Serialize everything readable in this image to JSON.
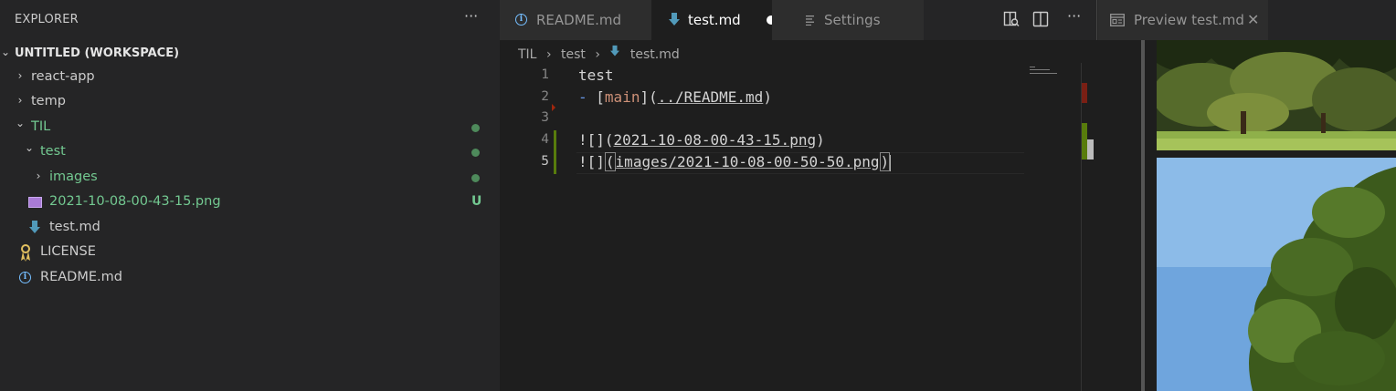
{
  "explorer": {
    "title": "EXPLORER",
    "more_icon": "ellipsis-icon",
    "more_label": "···",
    "workspace": "UNTITLED (WORKSPACE)",
    "items": [
      {
        "label": "react-app",
        "chevron": "›"
      },
      {
        "label": "temp",
        "chevron": "›"
      },
      {
        "label": "TIL",
        "chevron": "⌄"
      },
      {
        "label": "test",
        "chevron": "⌄"
      },
      {
        "label": "images",
        "chevron": "›"
      },
      {
        "label": "2021-10-08-00-43-15.png",
        "badge": "U"
      },
      {
        "label": "test.md"
      },
      {
        "label": "LICENSE",
        "icon_char": "🎗"
      },
      {
        "label": "README.md",
        "icon_char": "i"
      }
    ],
    "colors": {
      "modified": "#73c991",
      "dot": "#4e8a5b"
    }
  },
  "tabs": {
    "readme": {
      "label": "README.md",
      "icon": "info-icon",
      "icon_char": "i"
    },
    "testmd": {
      "label": "test.md",
      "icon": "markdown-icon"
    },
    "settings": {
      "label": "Settings",
      "icon": "settings-list-icon"
    }
  },
  "breadcrumb": {
    "items": [
      "TIL",
      "test",
      "test.md"
    ],
    "separator": "›"
  },
  "editor": {
    "line_numbers": [
      "1",
      "2",
      "3",
      "4",
      "5"
    ],
    "lines": {
      "l1": "test",
      "l2_bullet": "-",
      "l2_open": "[",
      "l2_text": "main",
      "l2_mid": "](",
      "l2_url": "../README.md",
      "l2_close": ")",
      "l4_prefix": "![](",
      "l4_url": "2021-10-08-00-43-15.png",
      "l4_close": ")",
      "l5_prefix": "![]",
      "l5_open": "(",
      "l5_url": "images/2021-10-08-00-50-50.png",
      "l5_close": ")"
    }
  },
  "preview": {
    "tab_label": "Preview test.md",
    "close_label": "✕"
  }
}
